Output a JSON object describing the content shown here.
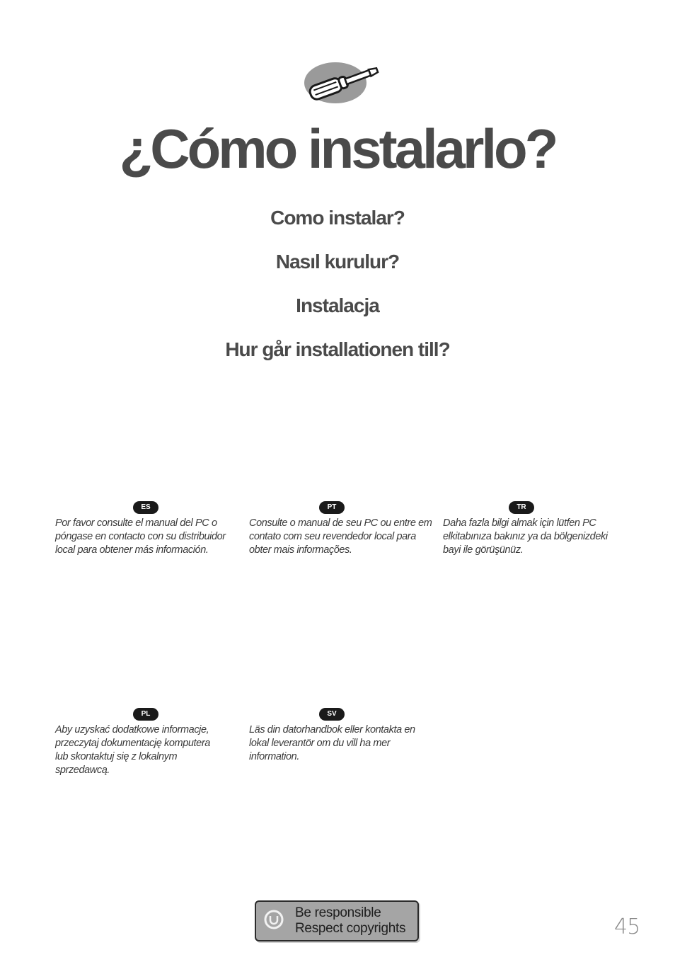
{
  "header": {
    "icon": "screwdriver-icon",
    "title": "¿Cómo instalarlo?",
    "subtitles": [
      "Como instalar?",
      "Nasıl kurulur?",
      "Instalacja",
      "Hur går installationen till?"
    ]
  },
  "languages": [
    {
      "code": "ES",
      "text": "Por favor consulte el manual del PC o póngase en contacto con su distribuidor local para obtener más información."
    },
    {
      "code": "PT",
      "text": "Consulte o manual de seu PC ou entre em contato com seu revendedor local para obter mais informações."
    },
    {
      "code": "TR",
      "text": "Daha fazla bilgi almak için lütfen PC elkitabınıza bakınız ya da bölgenizdeki bayi ile görüşünüz."
    },
    {
      "code": "PL",
      "text": "Aby uzyskać dodatkowe informacje, przeczytaj dokumentację komputera lub skontaktuj się z lokalnym sprzedawcą."
    },
    {
      "code": "SV",
      "text": "Läs din datorhandbok eller kontakta en lokal leverantör om du vill ha mer information."
    }
  ],
  "footer": {
    "badge_icon": "copyright-circle-icon",
    "badge_line1": "Be responsible",
    "badge_line2": "Respect copyrights",
    "page_number": "45"
  },
  "colors": {
    "heading": "#4a4a4a",
    "badge_bg": "#1a1a1a",
    "copyright_bg": "#a5a5a5"
  }
}
